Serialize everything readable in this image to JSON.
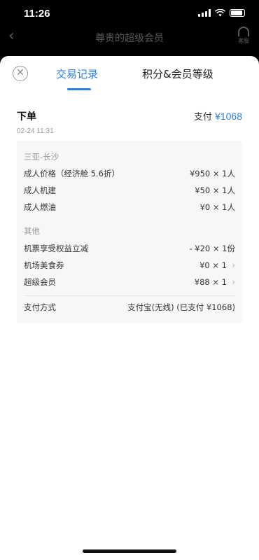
{
  "status": {
    "time": "11:26"
  },
  "behind": {
    "back_icon": "chevron-left-icon",
    "title": "尊贵的超级会员",
    "service_label": "客服"
  },
  "sheet": {
    "tabs": [
      {
        "label": "交易记录"
      },
      {
        "label": "积分&会员等级"
      }
    ]
  },
  "order": {
    "title": "下单",
    "time": "02-24  11:31",
    "pay_label": "支付",
    "pay_amount": "¥1068"
  },
  "detail": {
    "route_header": "三亚-长沙",
    "route_items": [
      {
        "label": "成人价格（经济舱 5.6折）",
        "value": "¥950 × 1人"
      },
      {
        "label": "成人机建",
        "value": "¥50 × 1人"
      },
      {
        "label": "成人燃油",
        "value": "¥0 × 1人"
      }
    ],
    "other_header": "其他",
    "other_items": [
      {
        "label": "机票享受权益立减",
        "value": "- ¥20 × 1份"
      },
      {
        "label": "机场美食券",
        "value": "¥0 × 1"
      },
      {
        "label": "超级会员",
        "value": "¥88 × 1"
      }
    ],
    "payment_label": "支付方式",
    "payment_value": "支付宝(无线) (已支付 ¥1068)"
  },
  "colors": {
    "accent": "#2b7fe0"
  }
}
